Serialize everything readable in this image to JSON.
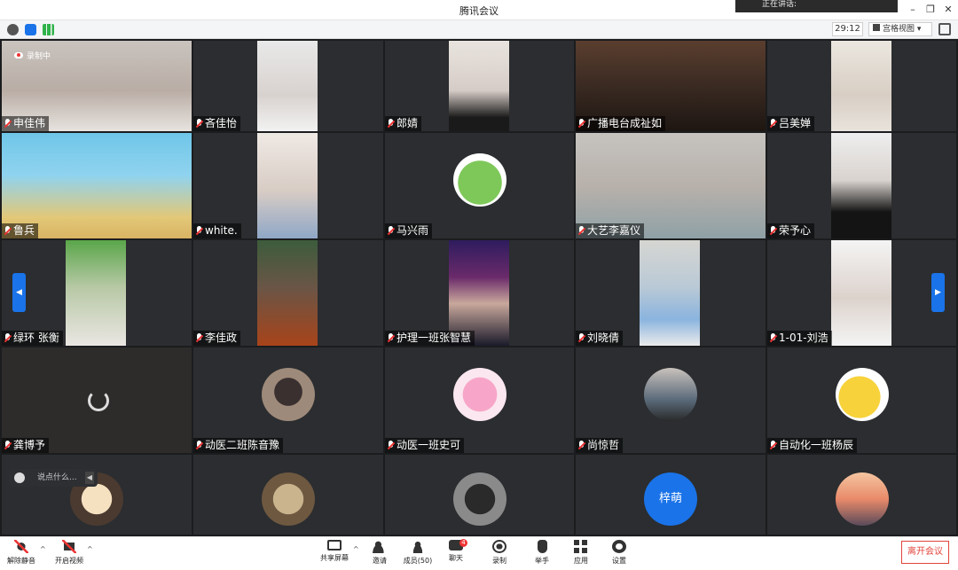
{
  "window": {
    "title": "腾讯会议",
    "speaking_label": "正在讲话:"
  },
  "status": {
    "timer": "29:12",
    "view_mode": "宫格视图"
  },
  "recording_label": "录制中",
  "chat_placeholder": "说点什么...",
  "participants": [
    {
      "name": "申佳伟"
    },
    {
      "name": "吝佳怡"
    },
    {
      "name": "郎婧"
    },
    {
      "name": "广播电台成祉如"
    },
    {
      "name": "吕美婵"
    },
    {
      "name": "鲁兵"
    },
    {
      "name": "white."
    },
    {
      "name": "马兴雨"
    },
    {
      "name": "大艺李嘉仪"
    },
    {
      "name": "荣予心"
    },
    {
      "name": "绿环 张衡"
    },
    {
      "name": "李佳政"
    },
    {
      "name": "护理一班张智慧"
    },
    {
      "name": "刘晓倩"
    },
    {
      "name": "1-01-刘浩"
    },
    {
      "name": "龚博予"
    },
    {
      "name": "动医二班陈音豫"
    },
    {
      "name": "动医一班史可"
    },
    {
      "name": "尚惊哲"
    },
    {
      "name": "自动化一班杨辰"
    },
    {
      "name": ""
    },
    {
      "name": ""
    },
    {
      "name": ""
    },
    {
      "name": "",
      "avatar_text": "梓萌"
    },
    {
      "name": ""
    }
  ],
  "toolbar": {
    "unmute": "解除静音",
    "start_video": "开启视频",
    "share_screen": "共享屏幕",
    "invite": "邀请",
    "members": "成员(50)",
    "chat": "聊天",
    "chat_badge": "4",
    "record": "录制",
    "raise_hand": "举手",
    "apps": "应用",
    "settings": "设置",
    "leave": "离开会议"
  },
  "colors": {
    "accent": "#1a73e8",
    "leave": "#e2453c",
    "grid_bg": "#1b1c1e",
    "tile_bg": "#2b2d30"
  }
}
